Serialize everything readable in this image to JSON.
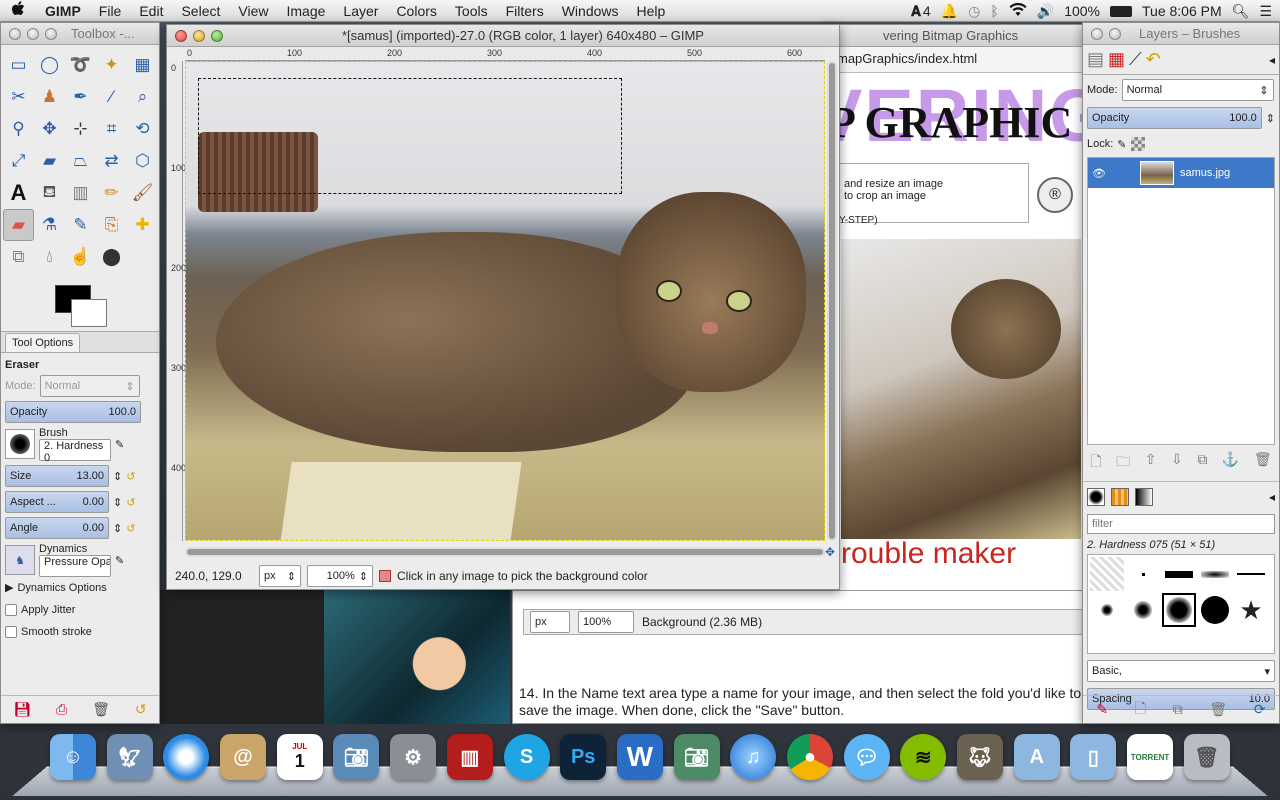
{
  "menubar": {
    "apple": "",
    "app": "GIMP",
    "items": [
      "File",
      "Edit",
      "Select",
      "View",
      "Image",
      "Layer",
      "Colors",
      "Tools",
      "Filters",
      "Windows",
      "Help"
    ],
    "status": {
      "adobe": "4",
      "battery": "100%",
      "clock": "Tue 8:06 PM"
    }
  },
  "toolbox": {
    "title": "Toolbox -...",
    "tool_options_tab": "Tool Options",
    "tool_name": "Eraser",
    "mode_label": "Mode:",
    "mode_value": "Normal",
    "opacity_label": "Opacity",
    "opacity_value": "100.0",
    "brush_label": "Brush",
    "brush_value": "2. Hardness 0",
    "size_label": "Size",
    "size_value": "13.00",
    "aspect_label": "Aspect ...",
    "aspect_value": "0.00",
    "angle_label": "Angle",
    "angle_value": "0.00",
    "dynamics_label": "Dynamics",
    "dynamics_value": "Pressure Opac",
    "dynamics_options": "Dynamics Options",
    "apply_jitter": "Apply Jitter",
    "smooth_stroke": "Smooth stroke"
  },
  "image_window": {
    "title": "*[samus] (imported)-27.0 (RGB color, 1 layer) 640x480 – GIMP",
    "ruler_marks": [
      "0",
      "100",
      "200",
      "300",
      "400",
      "500",
      "600"
    ],
    "vruler_marks": [
      "0",
      "100",
      "200",
      "300",
      "400"
    ],
    "coords": "240.0, 129.0",
    "unit": "px",
    "zoom": "100%",
    "status_msg": "Click in any image to pick the background color"
  },
  "browser": {
    "title": "vering Bitmap Graphics",
    "url": "mapGraphics/index.html",
    "heading": "P GRAPHIC",
    "banner_text": "VERING",
    "list_items": [
      "and resize an image",
      "to crop an image"
    ],
    "step_label": "Y-STEP)",
    "caption": "rouble maker",
    "status_unit": "px",
    "status_zoom": "100%",
    "status_bg": "Background (2.36 MB)",
    "instruction": "14. In the Name text area type a name for your image, and then select the fold you'd like to save the image. When done, click the \"Save\" button."
  },
  "layers": {
    "title": "Layers – Brushes",
    "mode_label": "Mode:",
    "mode_value": "Normal",
    "opacity_label": "Opacity",
    "opacity_value": "100.0",
    "lock_label": "Lock:",
    "layer_name": "samus.jpg",
    "filter_placeholder": "filter",
    "brush_name": "2. Hardness 075 (51 × 51)",
    "brush_set": "Basic,",
    "spacing_label": "Spacing",
    "spacing_value": "10.0"
  },
  "dock": {
    "apps": [
      "Finder",
      "Preview",
      "Safari",
      "Address Book",
      "iCal",
      "iPhoto",
      "System Preferences",
      "Photo Booth",
      "Skype",
      "Photoshop",
      "Word",
      "Image Capture",
      "iTunes",
      "Chrome",
      "Messages",
      "Spotify",
      "GIMP",
      "Applications",
      "Documents",
      "TORRENT",
      "Trash"
    ],
    "cal_day": "1",
    "cal_month": "JUL"
  },
  "colors": {
    "accent": "#3d79c8",
    "selection": "#d8e6f7"
  }
}
